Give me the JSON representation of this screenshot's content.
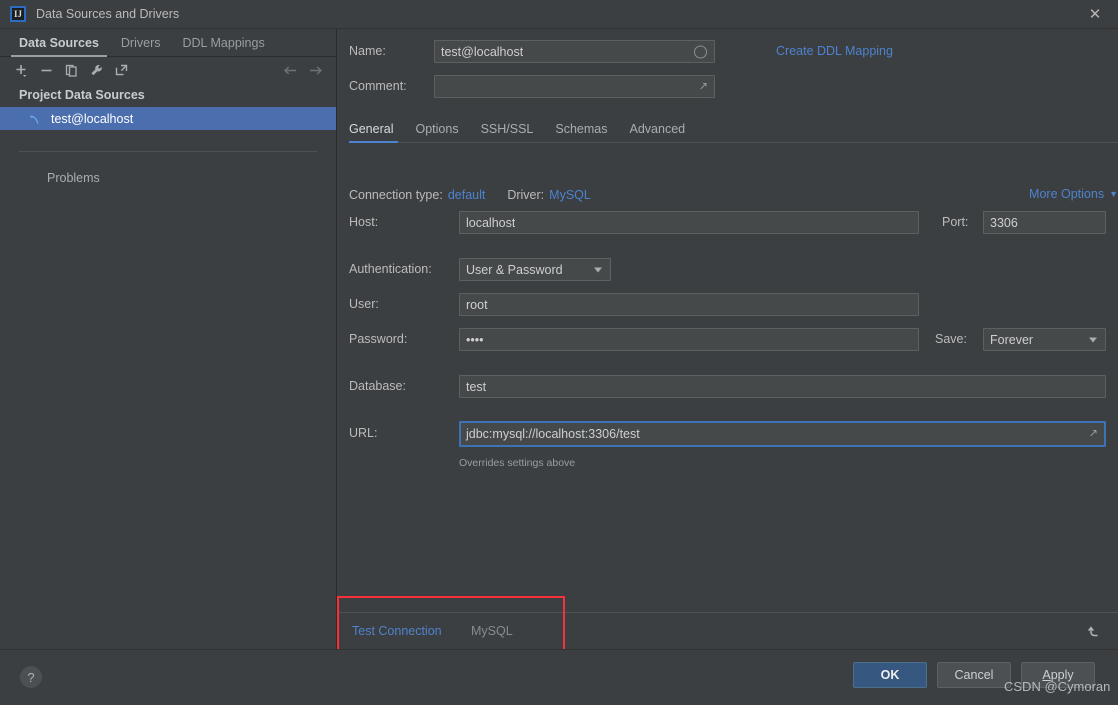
{
  "window": {
    "title": "Data Sources and Drivers",
    "logo_text": "IJ",
    "close_icon": "close-icon"
  },
  "left_panel": {
    "tabs": [
      {
        "label": "Data Sources",
        "active": true
      },
      {
        "label": "Drivers",
        "active": false
      },
      {
        "label": "DDL Mappings",
        "active": false
      }
    ],
    "toolbar": [
      {
        "name": "add-data-source-button",
        "icon": "plus-icon"
      },
      {
        "name": "remove-data-source-button",
        "icon": "minus-icon"
      },
      {
        "name": "duplicate-data-source-button",
        "icon": "copy-icon"
      },
      {
        "name": "properties-button",
        "icon": "wrench-icon"
      },
      {
        "name": "jump-to-button",
        "icon": "external-link-icon"
      },
      {
        "name": "navigate-back-button",
        "icon": "arrow-left-icon"
      },
      {
        "name": "navigate-forward-button",
        "icon": "arrow-right-icon"
      }
    ],
    "group_title": "Project Data Sources",
    "selected_item": {
      "label": "test@localhost",
      "icon": "mysql-dolphin-icon"
    },
    "problems_label": "Problems"
  },
  "form": {
    "name_label": "Name:",
    "name_value": "test@localhost",
    "name_status_icon": "circle-icon",
    "create_ddl_link": "Create DDL Mapping",
    "comment_label": "Comment:",
    "comment_value": "",
    "comment_expand_icon": "expand-icon",
    "tabs": [
      {
        "label": "General",
        "active": true
      },
      {
        "label": "Options",
        "active": false
      },
      {
        "label": "SSH/SSL",
        "active": false
      },
      {
        "label": "Schemas",
        "active": false
      },
      {
        "label": "Advanced",
        "active": false
      }
    ],
    "connection_type_label": "Connection type:",
    "connection_type_value": "default",
    "driver_label": "Driver:",
    "driver_value": "MySQL",
    "more_options_label": "More Options",
    "more_options_chevron": "chevron-down-icon",
    "host_label": "Host:",
    "host_value": "localhost",
    "port_label": "Port:",
    "port_value": "3306",
    "authentication_label": "Authentication:",
    "authentication_value": "User & Password",
    "user_label": "User:",
    "user_value": "root",
    "password_label": "Password:",
    "password_value": "••••",
    "save_label": "Save:",
    "save_value": "Forever",
    "database_label": "Database:",
    "database_value": "test",
    "url_label": "URL:",
    "url_prefix": "jdbc:mysql://localhost:3306/",
    "url_suffix": "test",
    "url_expand_icon": "expand-icon",
    "url_hint": "Overrides settings above"
  },
  "test_strip": {
    "test_connection_label": "Test Connection",
    "driver_name": "MySQL",
    "reset_icon": "reset-icon"
  },
  "bottom_bar": {
    "help_label": "?",
    "ok_label": "OK",
    "cancel_label": "Cancel",
    "apply_mnemonic": "A",
    "apply_rest": "pply"
  },
  "watermark": "CSDN @Cymoran",
  "colors": {
    "window_bg": "#3c3f41",
    "field_bg": "#45494a",
    "selection_blue": "#4b6eaf",
    "link_blue": "#4e82cd",
    "focus_blue": "#3d72b4",
    "ok_button": "#365880",
    "annotation_red": "#f8303a"
  }
}
